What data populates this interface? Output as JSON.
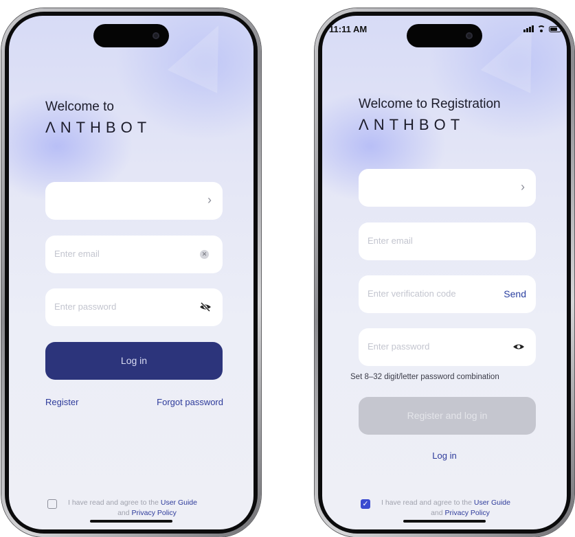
{
  "login": {
    "welcome": "Welcome to",
    "brand": "ΛNTHBOT",
    "email_placeholder": "Enter email",
    "password_placeholder": "Enter password",
    "login_button": "Log in",
    "register_link": "Register",
    "forgot_link": "Forgot password",
    "agree_prefix": "I have read and agree to the",
    "user_guide": "User Guide",
    "and": "and",
    "privacy": "Privacy Policy",
    "agree_checked": false
  },
  "register": {
    "status_time": "11:11 AM",
    "welcome": "Welcome to Registration",
    "brand": "ΛNTHBOT",
    "email_placeholder": "Enter email",
    "code_placeholder": "Enter verification code",
    "send_label": "Send",
    "password_placeholder": "Enter password",
    "password_hint": "Set 8–32 digit/letter password combination",
    "register_button": "Register and log in",
    "login_link": "Log in",
    "agree_prefix": "I have read and agree to the",
    "user_guide": "User Guide",
    "and": "and",
    "privacy": "Privacy Policy",
    "agree_checked": true
  },
  "icons": {
    "chevron": "chevron-right-icon",
    "clear": "clear-icon",
    "eye_hidden": "eye-slash-icon",
    "eye": "eye-icon"
  },
  "colors": {
    "primary": "#2c347b",
    "link": "#2d3a9a",
    "disabled": "#c5c6cf"
  }
}
